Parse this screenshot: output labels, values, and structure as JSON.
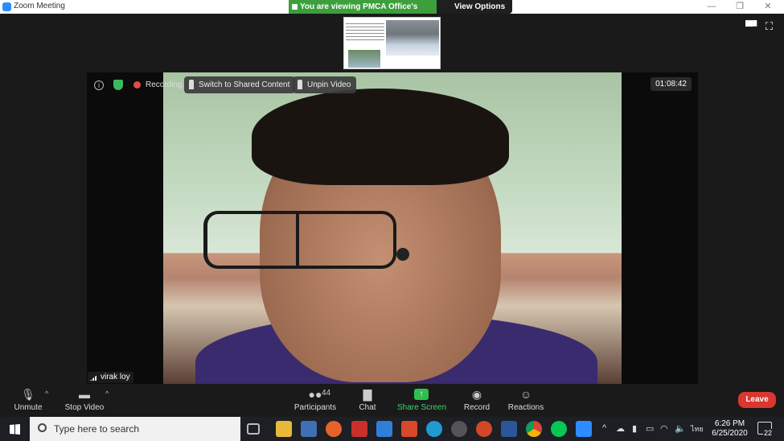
{
  "titlebar": {
    "title": "Zoom Meeting",
    "minimize": "—",
    "restore": "❐",
    "close": "✕"
  },
  "share_banner": {
    "viewing": "You are viewing PMCA Office's screen",
    "view_options": "View Options ⌄"
  },
  "video": {
    "recording_label": "Recording",
    "switch_label": "Switch to Shared Content",
    "unpin_label": "Unpin Video",
    "timer": "01:08:42",
    "participant_name": "virak loy"
  },
  "toolbar": {
    "unmute_label": "Unmute",
    "stop_video_label": "Stop Video",
    "participants_label": "Participants",
    "participants_count": "44",
    "chat_label": "Chat",
    "share_label": "Share Screen",
    "record_label": "Record",
    "reactions_label": "Reactions",
    "leave_label": "Leave"
  },
  "taskbar": {
    "search_placeholder": "Type here to search",
    "lang": "ไทย",
    "time": "6:26 PM",
    "date": "6/25/2020",
    "notifications": "22"
  },
  "colors": {
    "share_green": "#3c9f3c",
    "leave_red": "#d9372f",
    "accent_blue": "#2d8cff"
  }
}
